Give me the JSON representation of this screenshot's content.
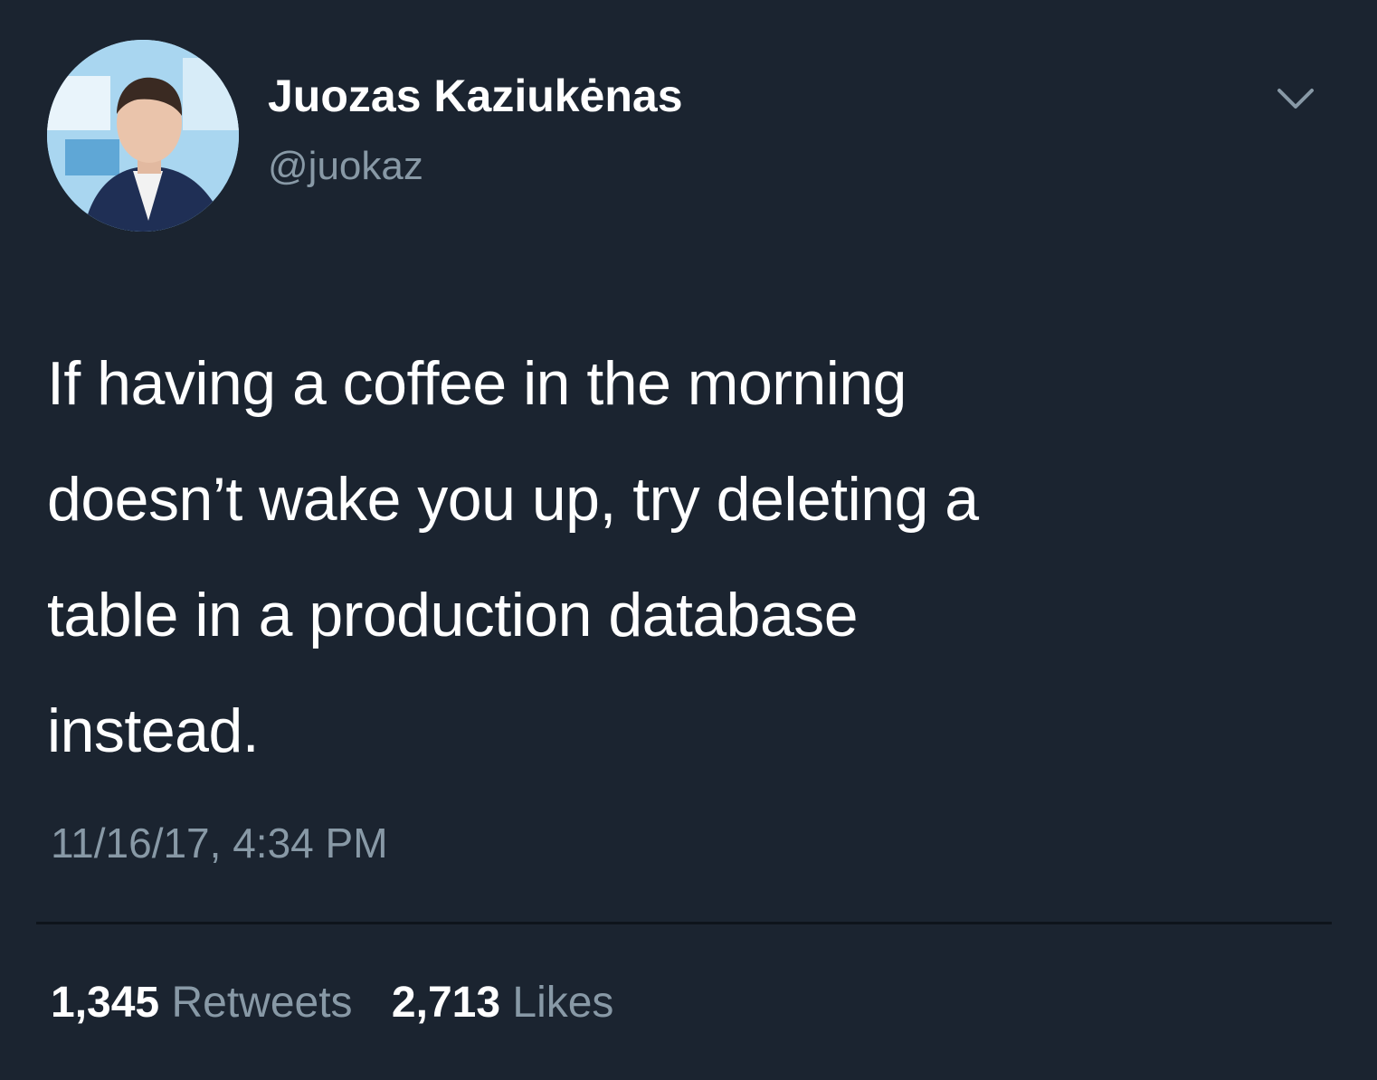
{
  "tweet": {
    "author": {
      "display_name": "Juozas Kaziukėnas",
      "handle": "@juokaz"
    },
    "text_lines": [
      "If having a coffee in the morning",
      "doesn’t wake you up, try deleting a",
      "table in a production database",
      "instead."
    ],
    "timestamp": "11/16/17, 4:34 PM",
    "stats": {
      "retweets_count": "1,345",
      "retweets_label": "Retweets",
      "likes_count": "2,713",
      "likes_label": "Likes"
    }
  },
  "icons": {
    "menu": "chevron-down-icon",
    "avatar": "profile-photo"
  },
  "colors": {
    "background": "#1b2430",
    "primary_text": "#ffffff",
    "secondary_text": "#8899a6",
    "divider": "#0e141b"
  }
}
